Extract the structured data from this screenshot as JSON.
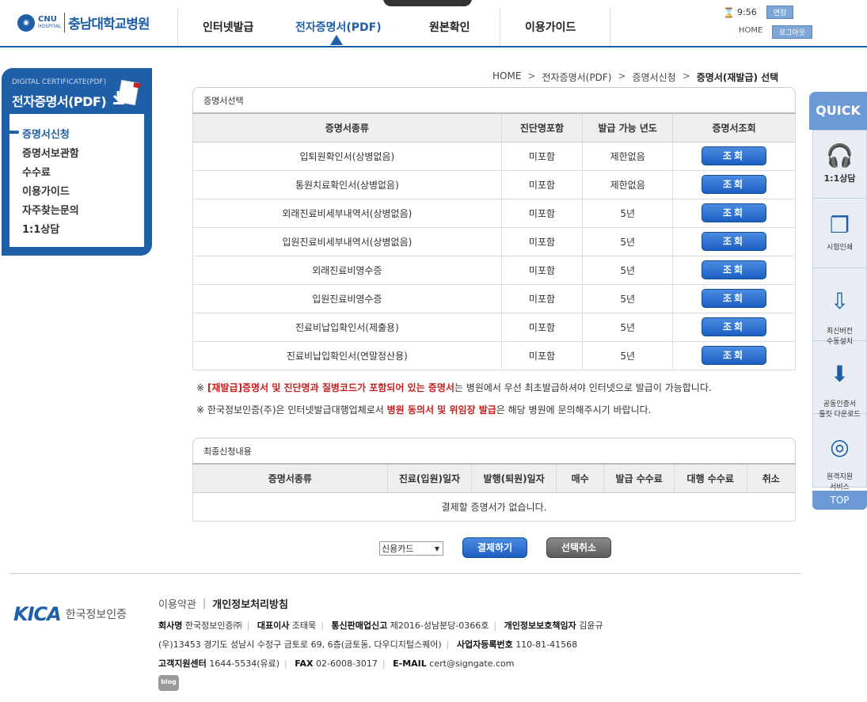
{
  "header": {
    "logo_abbr": "CNU",
    "logo_sub": "HOSPITAL",
    "logo_name": "충남대학교병원",
    "nav": [
      "인터넷발급",
      "전자증명서(PDF)",
      "원본확인",
      "이용가이드"
    ],
    "timer": "9:56",
    "extend_label": "연장",
    "home_label": "HOME",
    "logout_label": "로그아웃"
  },
  "sidebar": {
    "subtitle": "DIGITAL CERTIFICATE(PDF)",
    "title": "전자증명서(PDF)",
    "items": [
      "증명서신청",
      "증명서보관함",
      "수수료",
      "이용가이드",
      "자주찾는문의",
      "1:1상담"
    ]
  },
  "breadcrumb": [
    "HOME",
    "전자증명서(PDF)",
    "증명서신청",
    "증명서(재발급) 선택"
  ],
  "cert_section": {
    "title": "증명서선택",
    "headers": [
      "증명서종류",
      "진단명포함",
      "발급 가능 년도",
      "증명서조회"
    ],
    "button_label": "조회",
    "rows": [
      [
        "입퇴원확인서(상병없음)",
        "미포함",
        "제한없음"
      ],
      [
        "통원치료확인서(상병없음)",
        "미포함",
        "제한없음"
      ],
      [
        "외래진료비세부내역서(상병없음)",
        "미포함",
        "5년"
      ],
      [
        "입원진료비세부내역서(상병없음)",
        "미포함",
        "5년"
      ],
      [
        "외래진료비영수증",
        "미포함",
        "5년"
      ],
      [
        "입원진료비영수증",
        "미포함",
        "5년"
      ],
      [
        "진료비납입확인서(제출용)",
        "미포함",
        "5년"
      ],
      [
        "진료비납입확인서(연말정산용)",
        "미포함",
        "5년"
      ]
    ]
  },
  "notices": {
    "n1_pre": "※ ",
    "n1_bold": "[재발급]증명서 및 진단명과 질병코드가 포함되어 있는 증명서",
    "n1_post": "는 병원에서 우선 최초발급하셔야 인터넷으로 발급이 가능합니다.",
    "n2_pre": "※ 한국정보인증(주)은 인터넷발급대행업체로서 ",
    "n2_bold": "병원 동의서 및 위임장 발급",
    "n2_post": "은 해당 병원에 문의해주시기 바랍니다."
  },
  "request_section": {
    "title": "최종신청내용",
    "headers": [
      "증명서종류",
      "진료(입원)일자",
      "발행(퇴원)일자",
      "매수",
      "발급 수수료",
      "대행 수수료",
      "취소"
    ],
    "empty_message": "결제할 증명서가 없습니다."
  },
  "actions": {
    "payment_method": "신용카드",
    "pay_label": "결제하기",
    "cancel_label": "선택취소"
  },
  "footer": {
    "kica_logo": "KICA",
    "kica_name": "한국정보인증",
    "terms": "이용약관",
    "privacy": "개인정보처리방침",
    "line1": [
      {
        "k": "회사명",
        "v": "한국정보인증㈜"
      },
      {
        "k": "대표이사",
        "v": "조태묵"
      },
      {
        "k": "통신판매업신고",
        "v": "제2016-성남분당-0366호"
      },
      {
        "k": "개인정보보호책임자",
        "v": "김윤규"
      }
    ],
    "address": "(우)13453 경기도 성남시 수정구 금토로 69, 6층(금토동, 다우디지털스퀘어)",
    "biz_key": "사업자등록번호",
    "biz_val": "110-81-41568",
    "line3": [
      {
        "k": "고객지원센터",
        "v": "1644-5534(유료)"
      },
      {
        "k": "FAX",
        "v": "02-6008-3017"
      },
      {
        "k": "E-MAIL",
        "v": "cert@signgate.com"
      }
    ],
    "blog": "blog"
  },
  "quick": {
    "title": "QUICK",
    "items": [
      "1:1상담",
      "시험인쇄",
      "최신버전\n수동설치",
      "공동인증서\n툴킷 다운로드",
      "원격지원\n서비스"
    ],
    "top": "TOP"
  }
}
